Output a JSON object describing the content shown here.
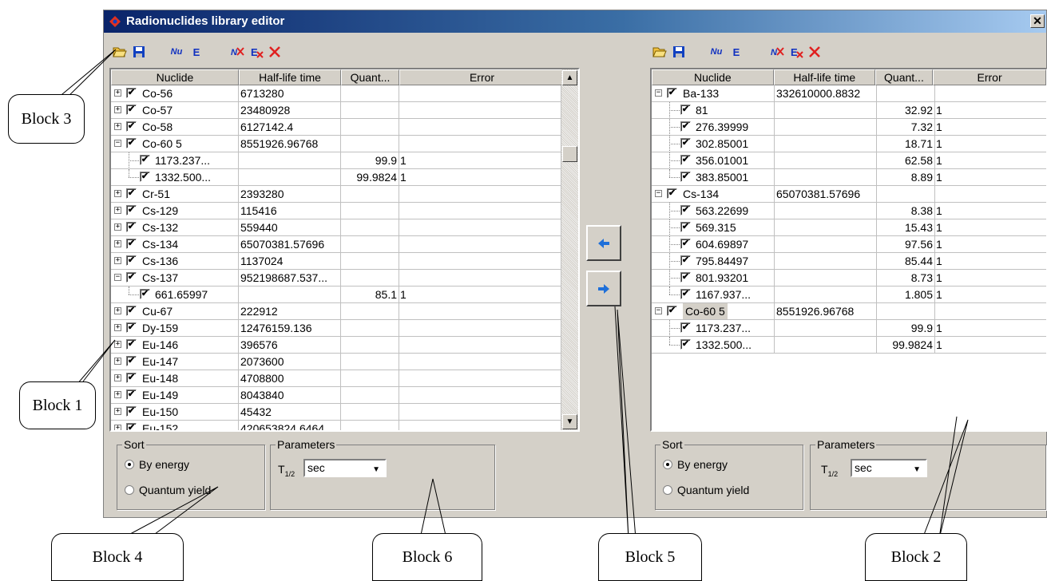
{
  "window": {
    "title": "Radionuclides library editor",
    "close_glyph": "✕"
  },
  "toolbar": {
    "nu_label": "Nu",
    "e_label": "E"
  },
  "left_grid": {
    "columns": [
      "Nuclide",
      "Half-life time",
      "Quant...",
      "Error"
    ],
    "rows": [
      {
        "name": "Co-56",
        "half": "6713280",
        "q": "",
        "err": "",
        "kind": "parent",
        "expanded": false
      },
      {
        "name": "Co-57",
        "half": "23480928",
        "q": "",
        "err": "",
        "kind": "parent",
        "expanded": false
      },
      {
        "name": "Co-58",
        "half": "6127142.4",
        "q": "",
        "err": "",
        "kind": "parent",
        "expanded": false
      },
      {
        "name": "Co-60  5",
        "half": "8551926.96768",
        "q": "",
        "err": "",
        "kind": "parent",
        "expanded": true
      },
      {
        "name": "1173.237...",
        "half": "",
        "q": "99.9",
        "err": "1",
        "kind": "child"
      },
      {
        "name": "1332.500...",
        "half": "",
        "q": "99.9824",
        "err": "1",
        "kind": "child",
        "last": true
      },
      {
        "name": "Cr-51",
        "half": "2393280",
        "q": "",
        "err": "",
        "kind": "parent",
        "expanded": false
      },
      {
        "name": "Cs-129",
        "half": "115416",
        "q": "",
        "err": "",
        "kind": "parent",
        "expanded": false
      },
      {
        "name": "Cs-132",
        "half": "559440",
        "q": "",
        "err": "",
        "kind": "parent",
        "expanded": false
      },
      {
        "name": "Cs-134",
        "half": "65070381.57696",
        "q": "",
        "err": "",
        "kind": "parent",
        "expanded": false
      },
      {
        "name": "Cs-136",
        "half": "1137024",
        "q": "",
        "err": "",
        "kind": "parent",
        "expanded": false
      },
      {
        "name": "Cs-137",
        "half": "952198687.537...",
        "q": "",
        "err": "",
        "kind": "parent",
        "expanded": true
      },
      {
        "name": "661.65997",
        "half": "",
        "q": "85.1",
        "err": "1",
        "kind": "child",
        "last": true
      },
      {
        "name": "Cu-67",
        "half": "222912",
        "q": "",
        "err": "",
        "kind": "parent",
        "expanded": false
      },
      {
        "name": "Dy-159",
        "half": "12476159.136",
        "q": "",
        "err": "",
        "kind": "parent",
        "expanded": false
      },
      {
        "name": "Eu-146",
        "half": "396576",
        "q": "",
        "err": "",
        "kind": "parent",
        "expanded": false
      },
      {
        "name": "Eu-147",
        "half": "2073600",
        "q": "",
        "err": "",
        "kind": "parent",
        "expanded": false
      },
      {
        "name": "Eu-148",
        "half": "4708800",
        "q": "",
        "err": "",
        "kind": "parent",
        "expanded": false
      },
      {
        "name": "Eu-149",
        "half": "8043840",
        "q": "",
        "err": "",
        "kind": "parent",
        "expanded": false
      },
      {
        "name": "Eu-150",
        "half": "45432",
        "q": "",
        "err": "",
        "kind": "parent",
        "expanded": false
      },
      {
        "name": "Eu-152",
        "half": "420653824.6464",
        "q": "",
        "err": "",
        "kind": "parent",
        "expanded": false
      }
    ]
  },
  "right_grid": {
    "columns": [
      "Nuclide",
      "Half-life time",
      "Quant...",
      "Error"
    ],
    "rows": [
      {
        "name": "Ba-133",
        "half": "332610000.8832",
        "q": "",
        "err": "",
        "kind": "parent",
        "expanded": true
      },
      {
        "name": "81",
        "half": "",
        "q": "32.92",
        "err": "1",
        "kind": "child"
      },
      {
        "name": "276.39999",
        "half": "",
        "q": "7.32",
        "err": "1",
        "kind": "child"
      },
      {
        "name": "302.85001",
        "half": "",
        "q": "18.71",
        "err": "1",
        "kind": "child"
      },
      {
        "name": "356.01001",
        "half": "",
        "q": "62.58",
        "err": "1",
        "kind": "child"
      },
      {
        "name": "383.85001",
        "half": "",
        "q": "8.89",
        "err": "1",
        "kind": "child",
        "last": true
      },
      {
        "name": "Cs-134",
        "half": "65070381.57696",
        "q": "",
        "err": "",
        "kind": "parent",
        "expanded": true
      },
      {
        "name": "563.22699",
        "half": "",
        "q": "8.38",
        "err": "1",
        "kind": "child"
      },
      {
        "name": "569.315",
        "half": "",
        "q": "15.43",
        "err": "1",
        "kind": "child"
      },
      {
        "name": "604.69897",
        "half": "",
        "q": "97.56",
        "err": "1",
        "kind": "child"
      },
      {
        "name": "795.84497",
        "half": "",
        "q": "85.44",
        "err": "1",
        "kind": "child"
      },
      {
        "name": "801.93201",
        "half": "",
        "q": "8.73",
        "err": "1",
        "kind": "child"
      },
      {
        "name": "1167.937...",
        "half": "",
        "q": "1.805",
        "err": "1",
        "kind": "child",
        "last": true
      },
      {
        "name": "Co-60  5",
        "half": "8551926.96768",
        "q": "",
        "err": "",
        "kind": "parent",
        "expanded": true,
        "selected": true
      },
      {
        "name": "1173.237...",
        "half": "",
        "q": "99.9",
        "err": "1",
        "kind": "child"
      },
      {
        "name": "1332.500...",
        "half": "",
        "q": "99.9824",
        "err": "1",
        "kind": "child",
        "last": true
      }
    ]
  },
  "left_panel": {
    "sort_title": "Sort",
    "sort_energy": "By energy",
    "sort_yield": "Quantum yield",
    "params_title": "Parameters",
    "t_label": "T",
    "t_sub": "1/2",
    "unit": "sec"
  },
  "right_panel": {
    "sort_title": "Sort",
    "sort_energy": "By energy",
    "sort_yield": "Quantum yield",
    "params_title": "Parameters",
    "t_label": "T",
    "t_sub": "1/2",
    "unit": "sec"
  },
  "callouts": {
    "block1": "Block 1",
    "block2": "Block 2",
    "block3": "Block 3",
    "block4": "Block 4",
    "block5": "Block 5",
    "block6": "Block 6"
  },
  "colors": {
    "title_start": "#0a246a",
    "title_end": "#a6caf0",
    "face": "#d4d0c8",
    "arrow_blue": "#1e6fd9"
  },
  "icons": [
    "open-folder-icon",
    "save-icon",
    "nu-icon",
    "e-icon",
    "nuclide-add-icon",
    "energy-delete-icon",
    "delete-icon",
    "arrow-left-icon",
    "arrow-right-icon"
  ]
}
